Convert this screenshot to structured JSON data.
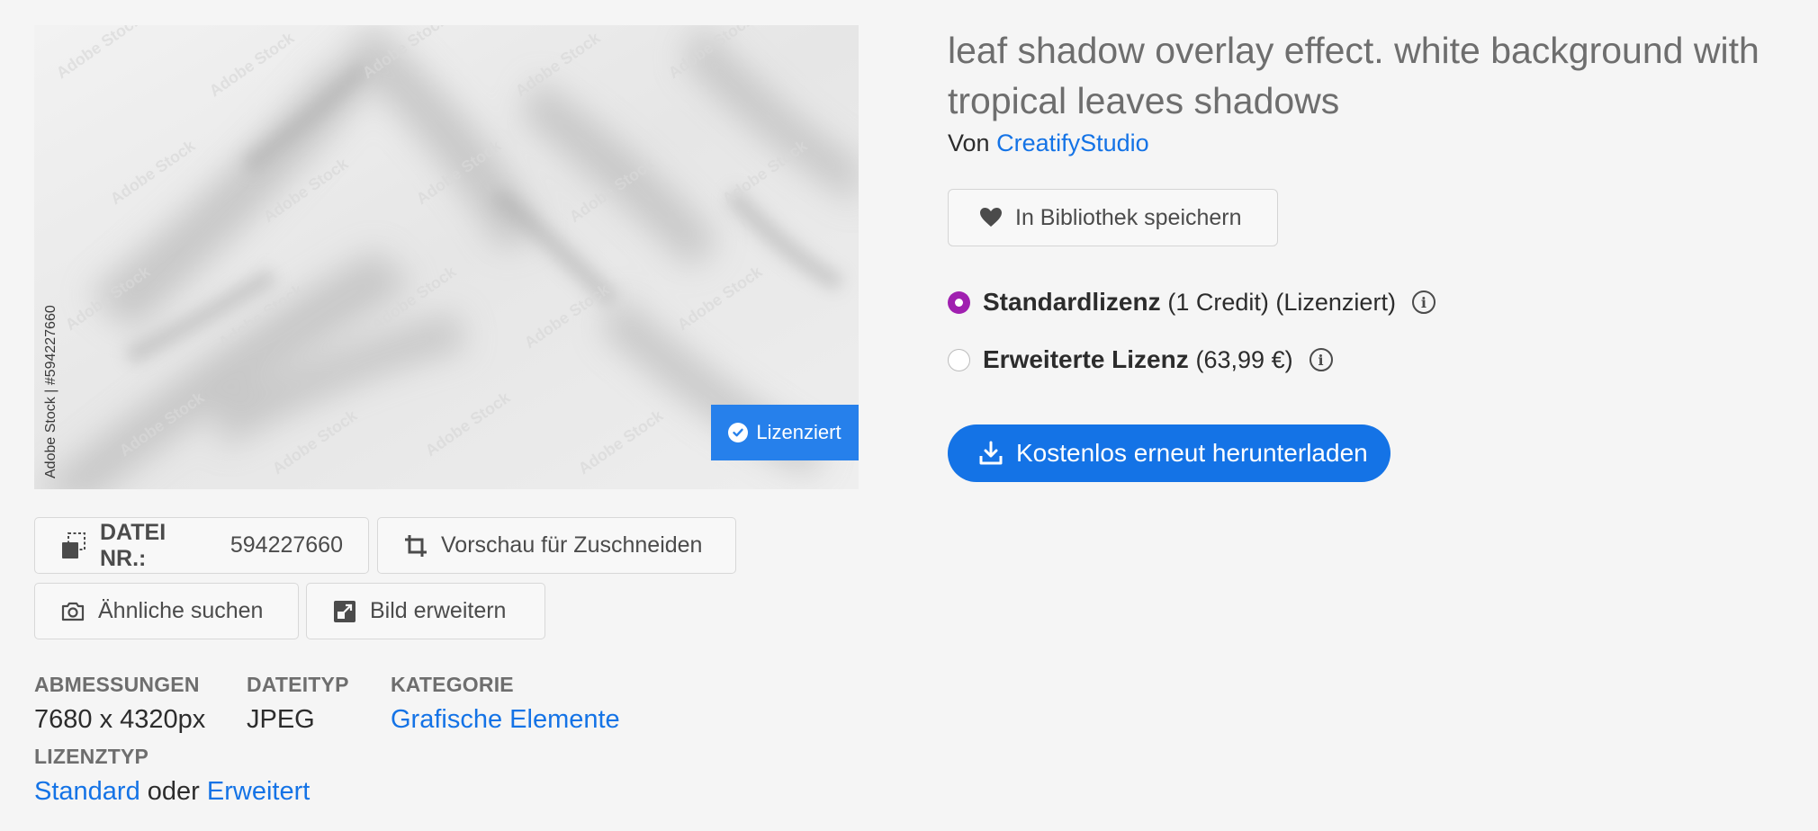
{
  "preview": {
    "watermark": "Adobe Stock",
    "side_credit": "Adobe Stock | #594227660",
    "licensed_badge": "Lizenziert"
  },
  "actions": {
    "file_label": "DATEI NR.:",
    "file_number": "594227660",
    "crop_preview": "Vorschau für Zuschneiden",
    "find_similar": "Ähnliche suchen",
    "expand_image": "Bild erweitern"
  },
  "meta": {
    "dimensions_label": "ABMESSUNGEN",
    "dimensions_value": "7680 x 4320px",
    "filetype_label": "DATEITYP",
    "filetype_value": "JPEG",
    "category_label": "KATEGORIE",
    "category_value": "Grafische Elemente",
    "license_type_label": "LIZENZTYP",
    "license_standard": "Standard",
    "license_or": "oder",
    "license_extended": "Erweitert"
  },
  "asset": {
    "title": "leaf shadow overlay effect. white background with tropical leaves shadows",
    "by_prefix": "Von",
    "author": "CreatifyStudio"
  },
  "save_button": "In Bibliothek speichern",
  "licenses": [
    {
      "name": "Standardlizenz",
      "detail": "(1 Credit) (Lizenziert)",
      "selected": true
    },
    {
      "name": "Erweiterte Lizenz",
      "detail": "(63,99 €)",
      "selected": false
    }
  ],
  "download_button": "Kostenlos erneut herunterladen",
  "colors": {
    "accent_blue": "#1473e6",
    "badge_blue": "#2680eb",
    "radio_selected": "#a020b0"
  }
}
